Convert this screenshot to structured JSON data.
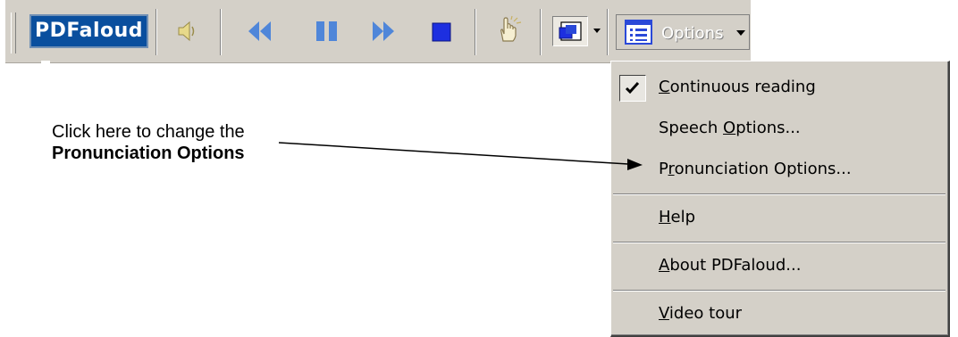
{
  "toolbar": {
    "brand": "PDFaloud",
    "buttons": [
      {
        "name": "speaker-icon"
      },
      {
        "name": "rewind-icon"
      },
      {
        "name": "pause-icon"
      },
      {
        "name": "fast-forward-icon"
      },
      {
        "name": "stop-icon"
      },
      {
        "name": "hand-pointer-icon"
      },
      {
        "name": "window-view-icon"
      }
    ],
    "options_label": "Options"
  },
  "menu": {
    "items": [
      {
        "label_pre": "",
        "accel": "C",
        "label_post": "ontinuous reading",
        "checked": true
      },
      {
        "label_pre": "Speech ",
        "accel": "O",
        "label_post": "ptions...",
        "checked": false
      },
      {
        "label_pre": "P",
        "accel": "r",
        "label_post": "onunciation Options...",
        "checked": false
      },
      {
        "label_pre": "",
        "accel": "H",
        "label_post": "elp",
        "checked": false
      },
      {
        "label_pre": "",
        "accel": "A",
        "label_post": "bout PDFaloud...",
        "checked": false
      },
      {
        "label_pre": "",
        "accel": "V",
        "label_post": "ideo tour",
        "checked": false
      }
    ]
  },
  "callout": {
    "line1": "Click here to change the",
    "line2": "Pronunciation Options"
  },
  "colors": {
    "toolbar_bg": "#d4d0c8",
    "brand_bg": "#0a4f9e",
    "media_blue": "#4f86d9",
    "stop_blue": "#1d2fe0"
  }
}
